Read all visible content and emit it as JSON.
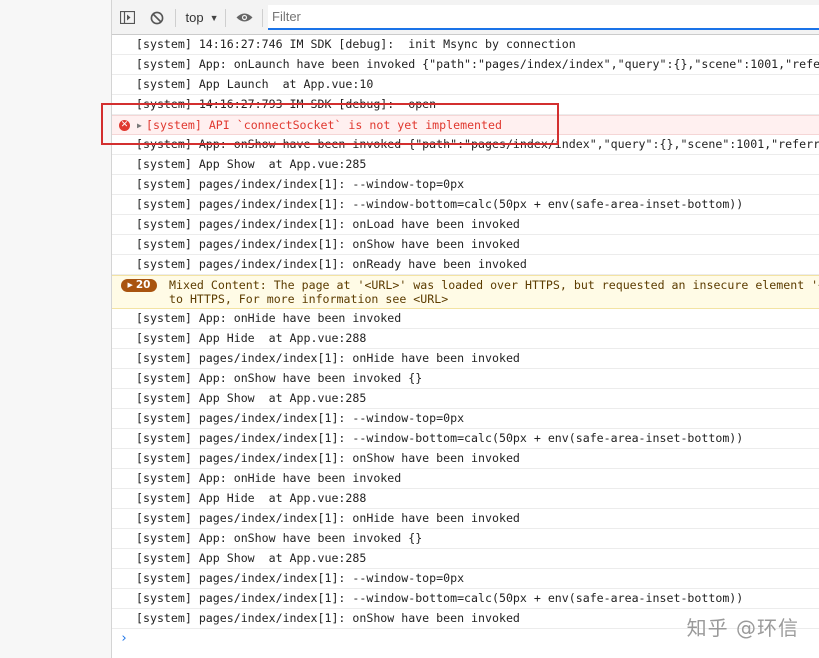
{
  "toolbar": {
    "context_label": "top",
    "filter_placeholder": "Filter"
  },
  "colors": {
    "error_text": "#e0382f",
    "error_bg": "#fff0f0",
    "warning_bg": "#fffbe6",
    "warning_badge": "#a9540f",
    "highlight_box": "#d32f2f",
    "filter_underline": "#1a73e8"
  },
  "icons": {
    "sidebar_toggle": "sidebar-icon",
    "clear": "clear-console-icon",
    "context_arrow": "chevron-down-icon",
    "live_expression": "eye-icon",
    "error": "error-icon",
    "prompt": "chevron-right-icon"
  },
  "messages": [
    {
      "type": "log",
      "text": "[system] 14:16:27:746 IM SDK [debug]:  init Msync by connection"
    },
    {
      "type": "log",
      "text": "[system] App: onLaunch have been invoked {\"path\":\"pages/index/index\",\"query\":{},\"scene\":1001,\"referrerInfo\":{}}"
    },
    {
      "type": "log",
      "text": "[system] App Launch  at App.vue:10"
    },
    {
      "type": "log",
      "text": "[system] 14:16:27:793 IM SDK [debug]:  open"
    },
    {
      "type": "error",
      "text": "[system] API `connectSocket` is not yet implemented"
    },
    {
      "type": "log",
      "text": "[system] App: onShow have been invoked {\"path\":\"pages/index/index\",\"query\":{},\"scene\":1001,\"referrerInfo\":{}}"
    },
    {
      "type": "log",
      "text": "[system] App Show  at App.vue:285"
    },
    {
      "type": "log",
      "text": "[system] pages/index/index[1]: --window-top=0px"
    },
    {
      "type": "log",
      "text": "[system] pages/index/index[1]: --window-bottom=calc(50px + env(safe-area-inset-bottom))"
    },
    {
      "type": "log",
      "text": "[system] pages/index/index[1]: onLoad have been invoked"
    },
    {
      "type": "log",
      "text": "[system] pages/index/index[1]: onShow have been invoked"
    },
    {
      "type": "log",
      "text": "[system] pages/index/index[1]: onReady have been invoked"
    },
    {
      "type": "warning",
      "count": "20",
      "line1": "Mixed Content: The page at '<URL>' was loaded over HTTPS, but requested an insecure element '<URL>'.",
      "line2": "to HTTPS, For more information see <URL>"
    },
    {
      "type": "log",
      "text": "[system] App: onHide have been invoked"
    },
    {
      "type": "log",
      "text": "[system] App Hide  at App.vue:288"
    },
    {
      "type": "log",
      "text": "[system] pages/index/index[1]: onHide have been invoked"
    },
    {
      "type": "log",
      "text": "[system] App: onShow have been invoked {}"
    },
    {
      "type": "log",
      "text": "[system] App Show  at App.vue:285"
    },
    {
      "type": "log",
      "text": "[system] pages/index/index[1]: --window-top=0px"
    },
    {
      "type": "log",
      "text": "[system] pages/index/index[1]: --window-bottom=calc(50px + env(safe-area-inset-bottom))"
    },
    {
      "type": "log",
      "text": "[system] pages/index/index[1]: onShow have been invoked"
    },
    {
      "type": "log",
      "text": "[system] App: onHide have been invoked"
    },
    {
      "type": "log",
      "text": "[system] App Hide  at App.vue:288"
    },
    {
      "type": "log",
      "text": "[system] pages/index/index[1]: onHide have been invoked"
    },
    {
      "type": "log",
      "text": "[system] App: onShow have been invoked {}"
    },
    {
      "type": "log",
      "text": "[system] App Show  at App.vue:285"
    },
    {
      "type": "log",
      "text": "[system] pages/index/index[1]: --window-top=0px"
    },
    {
      "type": "log",
      "text": "[system] pages/index/index[1]: --window-bottom=calc(50px + env(safe-area-inset-bottom))"
    },
    {
      "type": "log",
      "text": "[system] pages/index/index[1]: onShow have been invoked"
    }
  ],
  "prompt_symbol": "›",
  "watermark": "知乎 @环信"
}
